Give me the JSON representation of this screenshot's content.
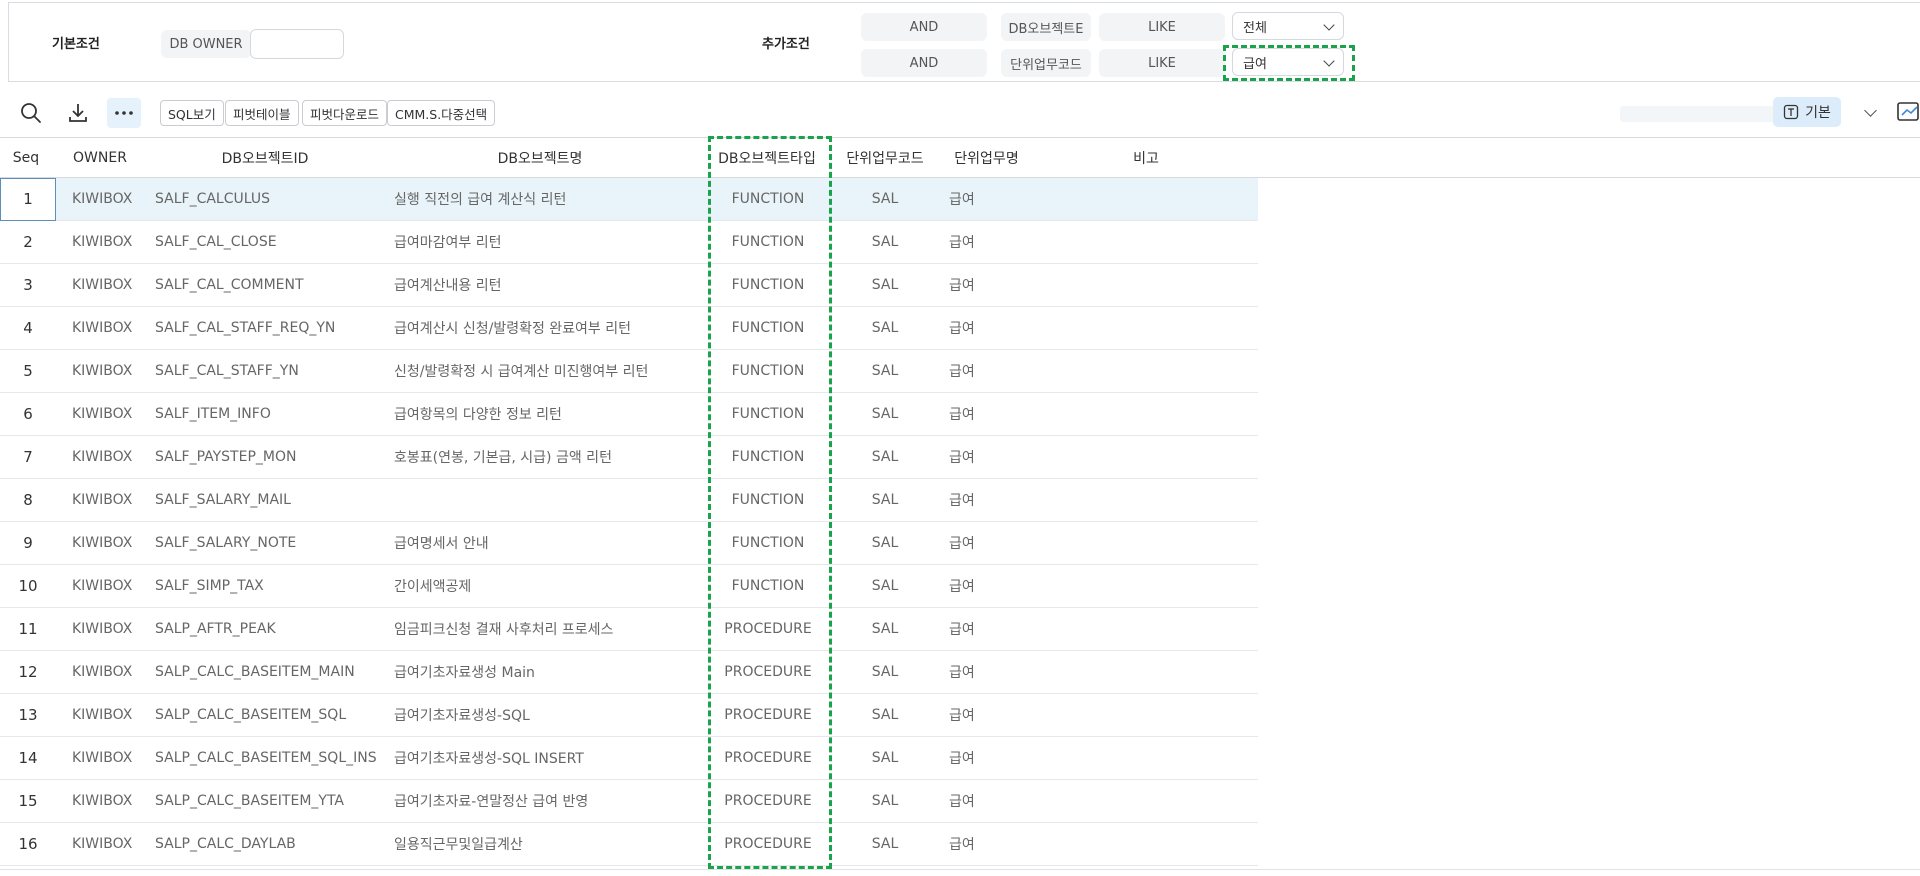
{
  "conditions": {
    "basic_title": "기본조건",
    "owner_label": "DB OWNER",
    "owner_value": "",
    "extra_title": "추가조건",
    "rows": [
      {
        "op": "AND",
        "field": "DB오브젝트E",
        "match": "LIKE",
        "value": "전체"
      },
      {
        "op": "AND",
        "field": "단위업무코드",
        "match": "LIKE",
        "value": "급여"
      }
    ]
  },
  "toolbar": {
    "icons": [
      "search-icon",
      "download-icon",
      "more-icon"
    ],
    "buttons": [
      "SQL보기",
      "피벗테이블",
      "피벗다운로드",
      "CMM.S.다중선택"
    ],
    "view_label": "기본"
  },
  "grid": {
    "columns": [
      "Seq",
      "OWNER",
      "DB오브젝트ID",
      "DB오브젝트명",
      "DB오브젝트타입",
      "단위업무코드",
      "단위업무명",
      "비고"
    ],
    "rows": [
      {
        "seq": "1",
        "owner": "KIWIBOX",
        "id": "SALF_CALCULUS",
        "name": "실행 직전의 급여 계산식 리턴",
        "type": "FUNCTION",
        "code": "SAL",
        "task": "급여",
        "note": ""
      },
      {
        "seq": "2",
        "owner": "KIWIBOX",
        "id": "SALF_CAL_CLOSE",
        "name": "급여마감여부 리턴",
        "type": "FUNCTION",
        "code": "SAL",
        "task": "급여",
        "note": ""
      },
      {
        "seq": "3",
        "owner": "KIWIBOX",
        "id": "SALF_CAL_COMMENT",
        "name": "급여계산내용 리턴",
        "type": "FUNCTION",
        "code": "SAL",
        "task": "급여",
        "note": ""
      },
      {
        "seq": "4",
        "owner": "KIWIBOX",
        "id": "SALF_CAL_STAFF_REQ_YN",
        "name": "급여계산시 신청/발령확정 완료여부 리턴",
        "type": "FUNCTION",
        "code": "SAL",
        "task": "급여",
        "note": ""
      },
      {
        "seq": "5",
        "owner": "KIWIBOX",
        "id": "SALF_CAL_STAFF_YN",
        "name": "신청/발령확정 시 급여계산 미진행여부 리턴",
        "type": "FUNCTION",
        "code": "SAL",
        "task": "급여",
        "note": ""
      },
      {
        "seq": "6",
        "owner": "KIWIBOX",
        "id": "SALF_ITEM_INFO",
        "name": "급여항목의 다양한 정보 리턴",
        "type": "FUNCTION",
        "code": "SAL",
        "task": "급여",
        "note": ""
      },
      {
        "seq": "7",
        "owner": "KIWIBOX",
        "id": "SALF_PAYSTEP_MON",
        "name": "호봉표(연봉, 기본급, 시급) 금액 리턴",
        "type": "FUNCTION",
        "code": "SAL",
        "task": "급여",
        "note": ""
      },
      {
        "seq": "8",
        "owner": "KIWIBOX",
        "id": "SALF_SALARY_MAIL",
        "name": "",
        "type": "FUNCTION",
        "code": "SAL",
        "task": "급여",
        "note": ""
      },
      {
        "seq": "9",
        "owner": "KIWIBOX",
        "id": "SALF_SALARY_NOTE",
        "name": "급여명세서 안내",
        "type": "FUNCTION",
        "code": "SAL",
        "task": "급여",
        "note": ""
      },
      {
        "seq": "10",
        "owner": "KIWIBOX",
        "id": "SALF_SIMP_TAX",
        "name": "간이세액공제",
        "type": "FUNCTION",
        "code": "SAL",
        "task": "급여",
        "note": ""
      },
      {
        "seq": "11",
        "owner": "KIWIBOX",
        "id": "SALP_AFTR_PEAK",
        "name": "임금피크신청 결재 사후처리 프로세스",
        "type": "PROCEDURE",
        "code": "SAL",
        "task": "급여",
        "note": ""
      },
      {
        "seq": "12",
        "owner": "KIWIBOX",
        "id": "SALP_CALC_BASEITEM_MAIN",
        "name": "급여기초자료생성 Main",
        "type": "PROCEDURE",
        "code": "SAL",
        "task": "급여",
        "note": ""
      },
      {
        "seq": "13",
        "owner": "KIWIBOX",
        "id": "SALP_CALC_BASEITEM_SQL",
        "name": "급여기초자료생성-SQL",
        "type": "PROCEDURE",
        "code": "SAL",
        "task": "급여",
        "note": ""
      },
      {
        "seq": "14",
        "owner": "KIWIBOX",
        "id": "SALP_CALC_BASEITEM_SQL_INS",
        "name": "급여기초자료생성-SQL INSERT",
        "type": "PROCEDURE",
        "code": "SAL",
        "task": "급여",
        "note": ""
      },
      {
        "seq": "15",
        "owner": "KIWIBOX",
        "id": "SALP_CALC_BASEITEM_YTA",
        "name": "급여기초자료-연말정산 급여 반영",
        "type": "PROCEDURE",
        "code": "SAL",
        "task": "급여",
        "note": ""
      },
      {
        "seq": "16",
        "owner": "KIWIBOX",
        "id": "SALP_CALC_DAYLAB",
        "name": "일용직근무및일급계산",
        "type": "PROCEDURE",
        "code": "SAL",
        "task": "급여",
        "note": ""
      }
    ]
  },
  "colors": {
    "highlight_dash": "#1aa34a",
    "selected_row": "#e9f4fa",
    "view_button": "#dcecfa"
  }
}
